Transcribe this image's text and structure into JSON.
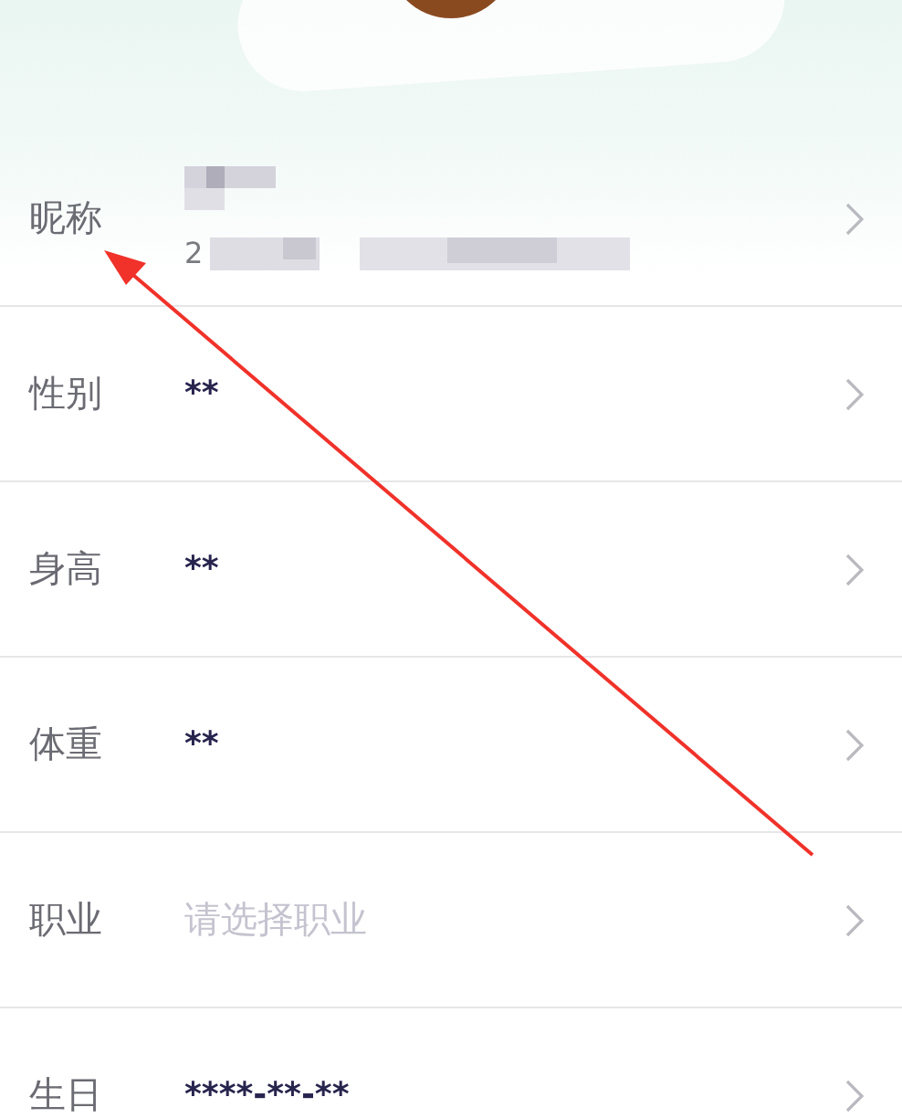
{
  "rows": [
    {
      "label": "昵称",
      "kind": "nickname",
      "subtitle_prefix": "2"
    },
    {
      "label": "性别",
      "kind": "value",
      "value": "**"
    },
    {
      "label": "身高",
      "kind": "value",
      "value": "**"
    },
    {
      "label": "体重",
      "kind": "value",
      "value": "**"
    },
    {
      "label": "职业",
      "kind": "placeholder",
      "placeholder": "请选择职业"
    },
    {
      "label": "生日",
      "kind": "value",
      "value": "****-**-**"
    }
  ]
}
